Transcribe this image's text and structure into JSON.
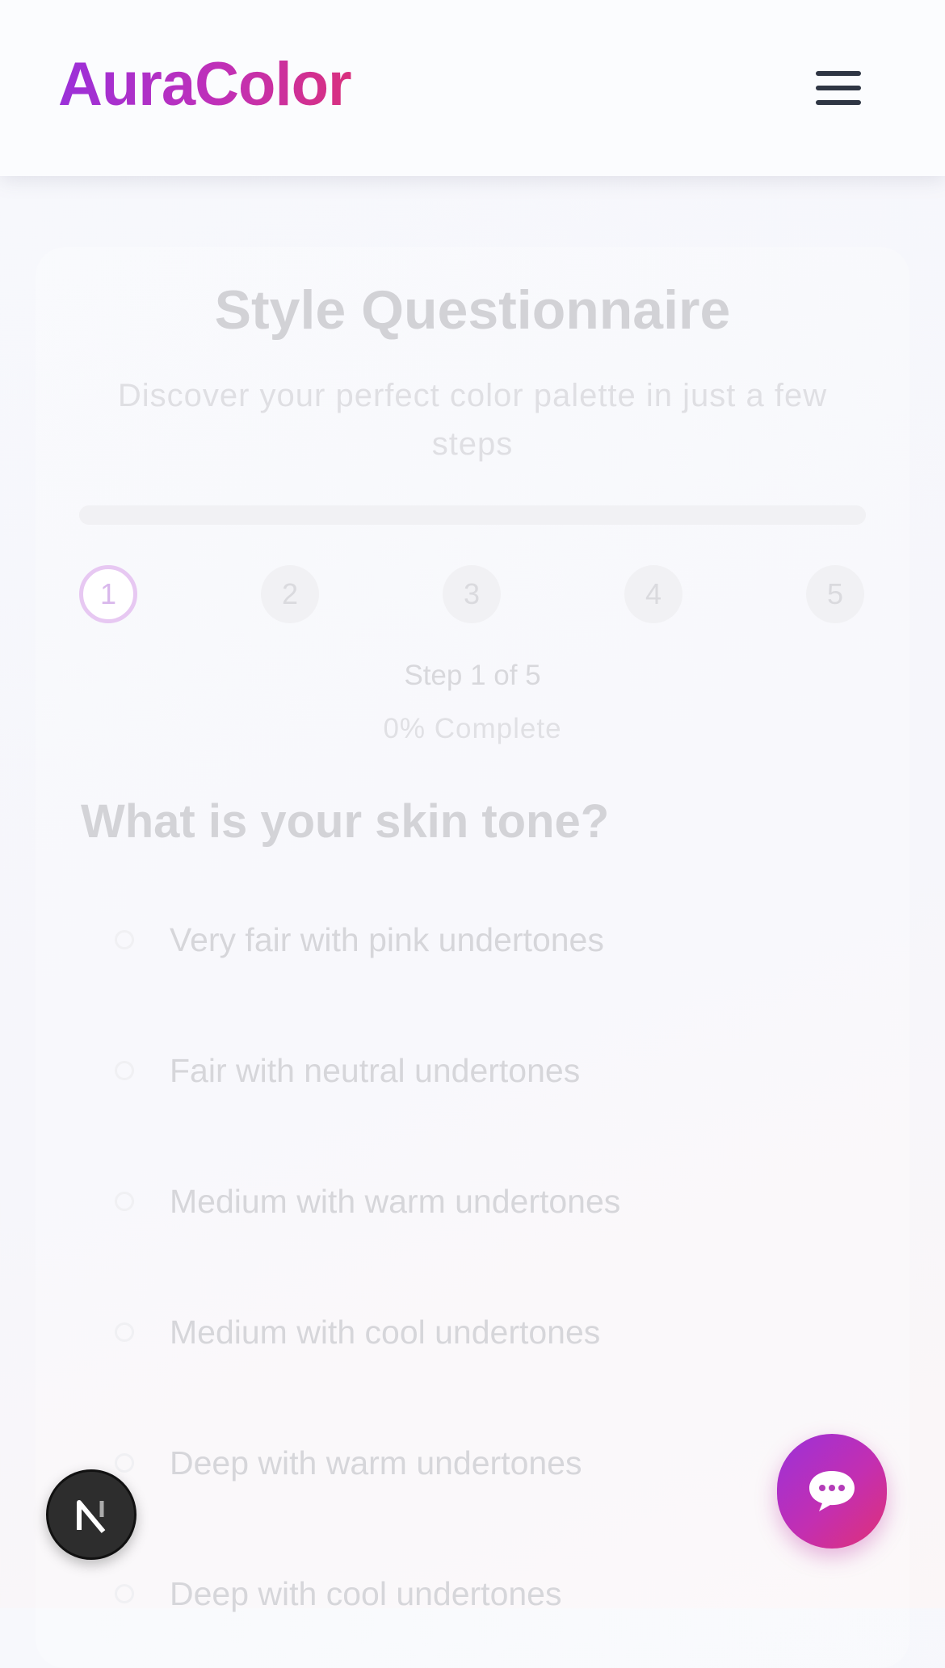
{
  "header": {
    "brand": "AuraColor",
    "menu_icon": "hamburger-menu-icon"
  },
  "questionnaire": {
    "title": "Style Questionnaire",
    "subtitle": "Discover your perfect color palette in just a few steps",
    "progress_fraction": 0,
    "steps": [
      "1",
      "2",
      "3",
      "4",
      "5"
    ],
    "active_step": 1,
    "step_text": "Step 1 of 5",
    "percent_text": "0% Complete"
  },
  "question": {
    "text": "What is your skin tone?",
    "options": [
      "Very fair with pink undertones",
      "Fair with neutral undertones",
      "Medium with warm undertones",
      "Medium with cool undertones",
      "Deep with warm undertones",
      "Deep with cool undertones"
    ]
  },
  "floating": {
    "dev_badge_icon": "nextjs-logo-icon",
    "chat_icon": "chat-bubble-icon"
  },
  "colors": {
    "brand_gradient_start": "#9b30d9",
    "brand_gradient_end": "#d9307e",
    "active_step_ring": "#e7c8f2"
  }
}
